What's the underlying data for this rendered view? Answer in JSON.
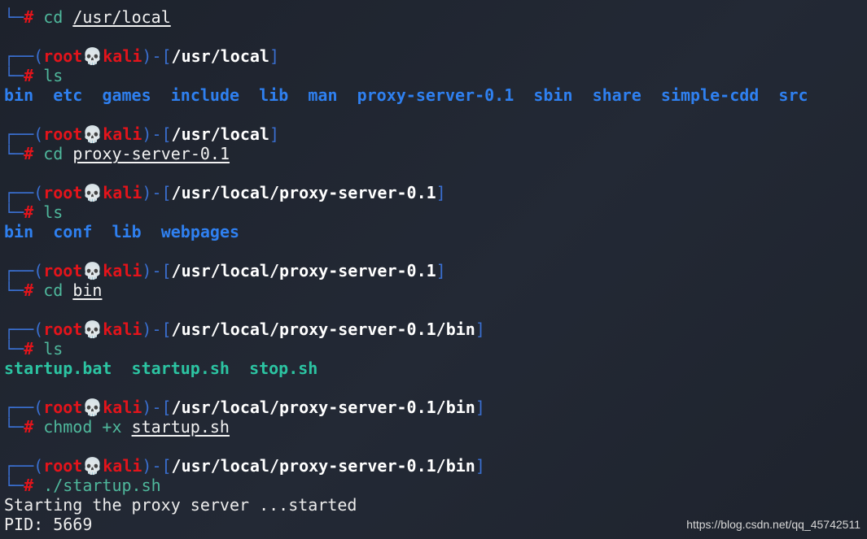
{
  "prompt": {
    "user": "root",
    "host": "kali",
    "skull": "💀",
    "hash": "#"
  },
  "blocks": [
    {
      "cmd": "cd",
      "arg": "/usr/local",
      "no_prompt_line": true
    },
    {
      "path": "/usr/local",
      "cmd": "ls",
      "output": {
        "kind": "dir",
        "items": [
          "bin",
          "etc",
          "games",
          "include",
          "lib",
          "man",
          "proxy-server-0.1",
          "sbin",
          "share",
          "simple-cdd",
          "src"
        ]
      }
    },
    {
      "path": "/usr/local",
      "cmd": "cd",
      "arg": "proxy-server-0.1"
    },
    {
      "path": "/usr/local/proxy-server-0.1",
      "cmd": "ls",
      "output": {
        "kind": "dir",
        "items": [
          "bin",
          "conf",
          "lib",
          "webpages"
        ]
      }
    },
    {
      "path": "/usr/local/proxy-server-0.1",
      "cmd": "cd",
      "arg": "bin"
    },
    {
      "path": "/usr/local/proxy-server-0.1/bin",
      "cmd": "ls",
      "output": {
        "kind": "exe",
        "items": [
          "startup.bat",
          "startup.sh",
          "stop.sh"
        ]
      }
    },
    {
      "path": "/usr/local/proxy-server-0.1/bin",
      "cmd": "chmod +x",
      "arg": "startup.sh"
    },
    {
      "path": "/usr/local/proxy-server-0.1/bin",
      "cmd": "./startup.sh",
      "output": {
        "kind": "text",
        "items": [
          "Starting the proxy server ...started",
          "PID: 5669"
        ]
      }
    }
  ],
  "watermark": "https://blog.csdn.net/qq_45742511",
  "colors": {
    "background": "#1c212b",
    "prompt_red": "#e3141b",
    "prompt_box": "#3a6fd0",
    "command": "#4fb89c",
    "directory": "#2f80f0",
    "executable": "#2cc4a2"
  }
}
